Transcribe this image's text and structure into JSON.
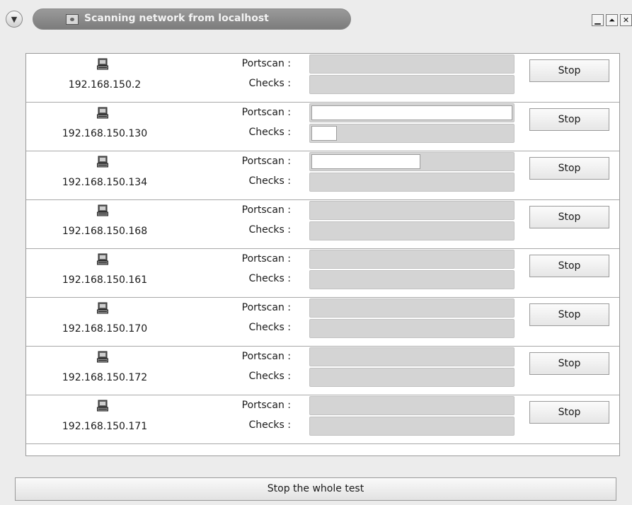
{
  "window": {
    "title": "Scanning network from localhost",
    "menu_icon": "chevron-down-icon",
    "title_icon": "eye-icon",
    "controls": [
      {
        "name": "minimize-button",
        "glyph": "▁"
      },
      {
        "name": "maximize-button",
        "glyph": "⏶"
      },
      {
        "name": "close-button",
        "glyph": "✕"
      }
    ]
  },
  "labels": {
    "portscan": "Portscan :",
    "checks": "Checks :",
    "stop": "Stop"
  },
  "hosts": [
    {
      "ip": "192.168.150.2",
      "portscan_progress": 0,
      "checks_progress": 0
    },
    {
      "ip": "192.168.150.130",
      "portscan_progress": 1.0,
      "checks_progress": 0.14
    },
    {
      "ip": "192.168.150.134",
      "portscan_progress": 0.55,
      "checks_progress": 0
    },
    {
      "ip": "192.168.150.168",
      "portscan_progress": 0,
      "checks_progress": 0
    },
    {
      "ip": "192.168.150.161",
      "portscan_progress": 0,
      "checks_progress": 0
    },
    {
      "ip": "192.168.150.170",
      "portscan_progress": 0,
      "checks_progress": 0
    },
    {
      "ip": "192.168.150.172",
      "portscan_progress": 0,
      "checks_progress": 0
    },
    {
      "ip": "192.168.150.171",
      "portscan_progress": 0,
      "checks_progress": 0
    }
  ],
  "stop_all_label": "Stop the whole test",
  "colors": {
    "title_pill": "#8a8a8a",
    "bar_empty": "#d4d4d4",
    "bar_fill": "#ffffff"
  }
}
